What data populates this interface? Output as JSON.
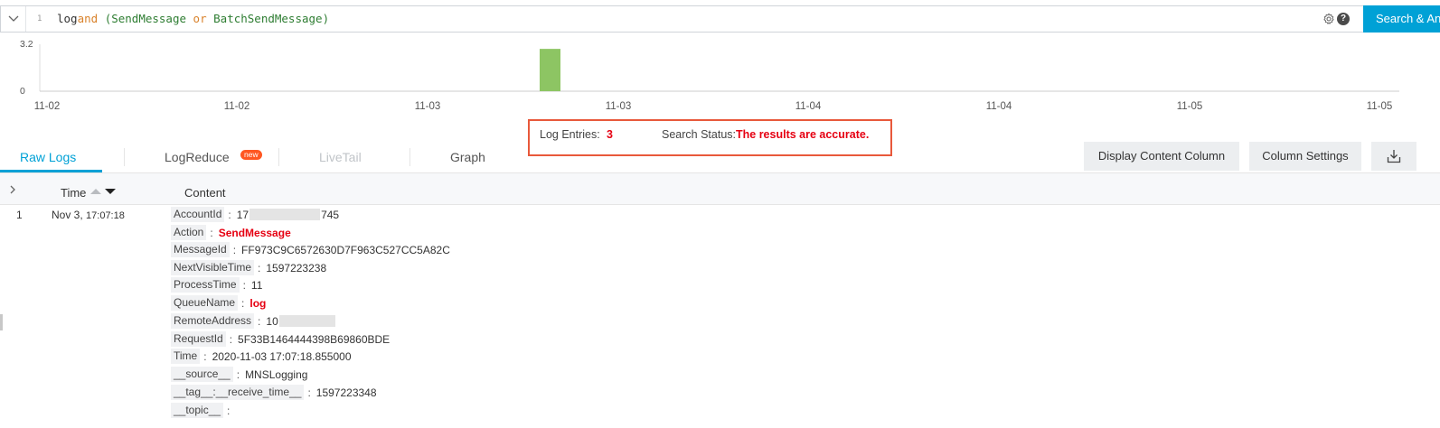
{
  "query": {
    "line_number": "1",
    "tokens": {
      "t1": "log",
      "t2": "and",
      "t3": "(",
      "t4": "SendMessage",
      "t5": "or",
      "t6": "BatchSendMessage",
      "t7": ")"
    },
    "help_label": "?",
    "search_label": "Search & Analyze"
  },
  "histogram": {
    "type": "bar",
    "y_ticks": [
      "3.2",
      "0"
    ],
    "ylim": [
      0,
      3.2
    ],
    "x_ticks": [
      "11-02",
      "11-02",
      "11-03",
      "11-03",
      "11-04",
      "11-04",
      "11-05",
      "11-05"
    ],
    "bar_value": 3,
    "bar_color": "#8dc563"
  },
  "summary": {
    "entries_label": "Log Entries:",
    "entries_value": "3",
    "status_label": "Search Status:",
    "status_value": "The results are accurate."
  },
  "tabs": {
    "raw_logs": "Raw Logs",
    "log_reduce": "LogReduce",
    "new_badge": "new",
    "live_tail": "LiveTail",
    "graph": "Graph"
  },
  "toolbar": {
    "display_content_column": "Display Content Column",
    "column_settings": "Column Settings"
  },
  "table": {
    "time_header": "Time",
    "content_header": "Content",
    "row": {
      "index": "1",
      "date": "Nov 3,",
      "time": "17:07:18",
      "fields": [
        {
          "key": "AccountId",
          "value": "17",
          "value_tail": "745"
        },
        {
          "key": "Action",
          "value": "SendMessage"
        },
        {
          "key": "MessageId",
          "value": "FF973C9C6572630D7F963C527CC5A82C"
        },
        {
          "key": "NextVisibleTime",
          "value": "1597223238"
        },
        {
          "key": "ProcessTime",
          "value": "11"
        },
        {
          "key": "QueueName",
          "value": "log"
        },
        {
          "key": "RemoteAddress",
          "value": "10"
        },
        {
          "key": "RequestId",
          "value": "5F33B1464444398B69860BDE"
        },
        {
          "key": "Time",
          "value": "2020-11-03 17:07:18.855000"
        },
        {
          "key": "__source__",
          "value": "MNSLogging"
        },
        {
          "key": "__tag__:__receive_time__",
          "value": "1597223348"
        },
        {
          "key": "__topic__",
          "value": ""
        }
      ]
    }
  },
  "colors": {
    "accent": "#00a1d6",
    "highlight_red": "#e60012",
    "annotation_border": "#e8593b"
  }
}
